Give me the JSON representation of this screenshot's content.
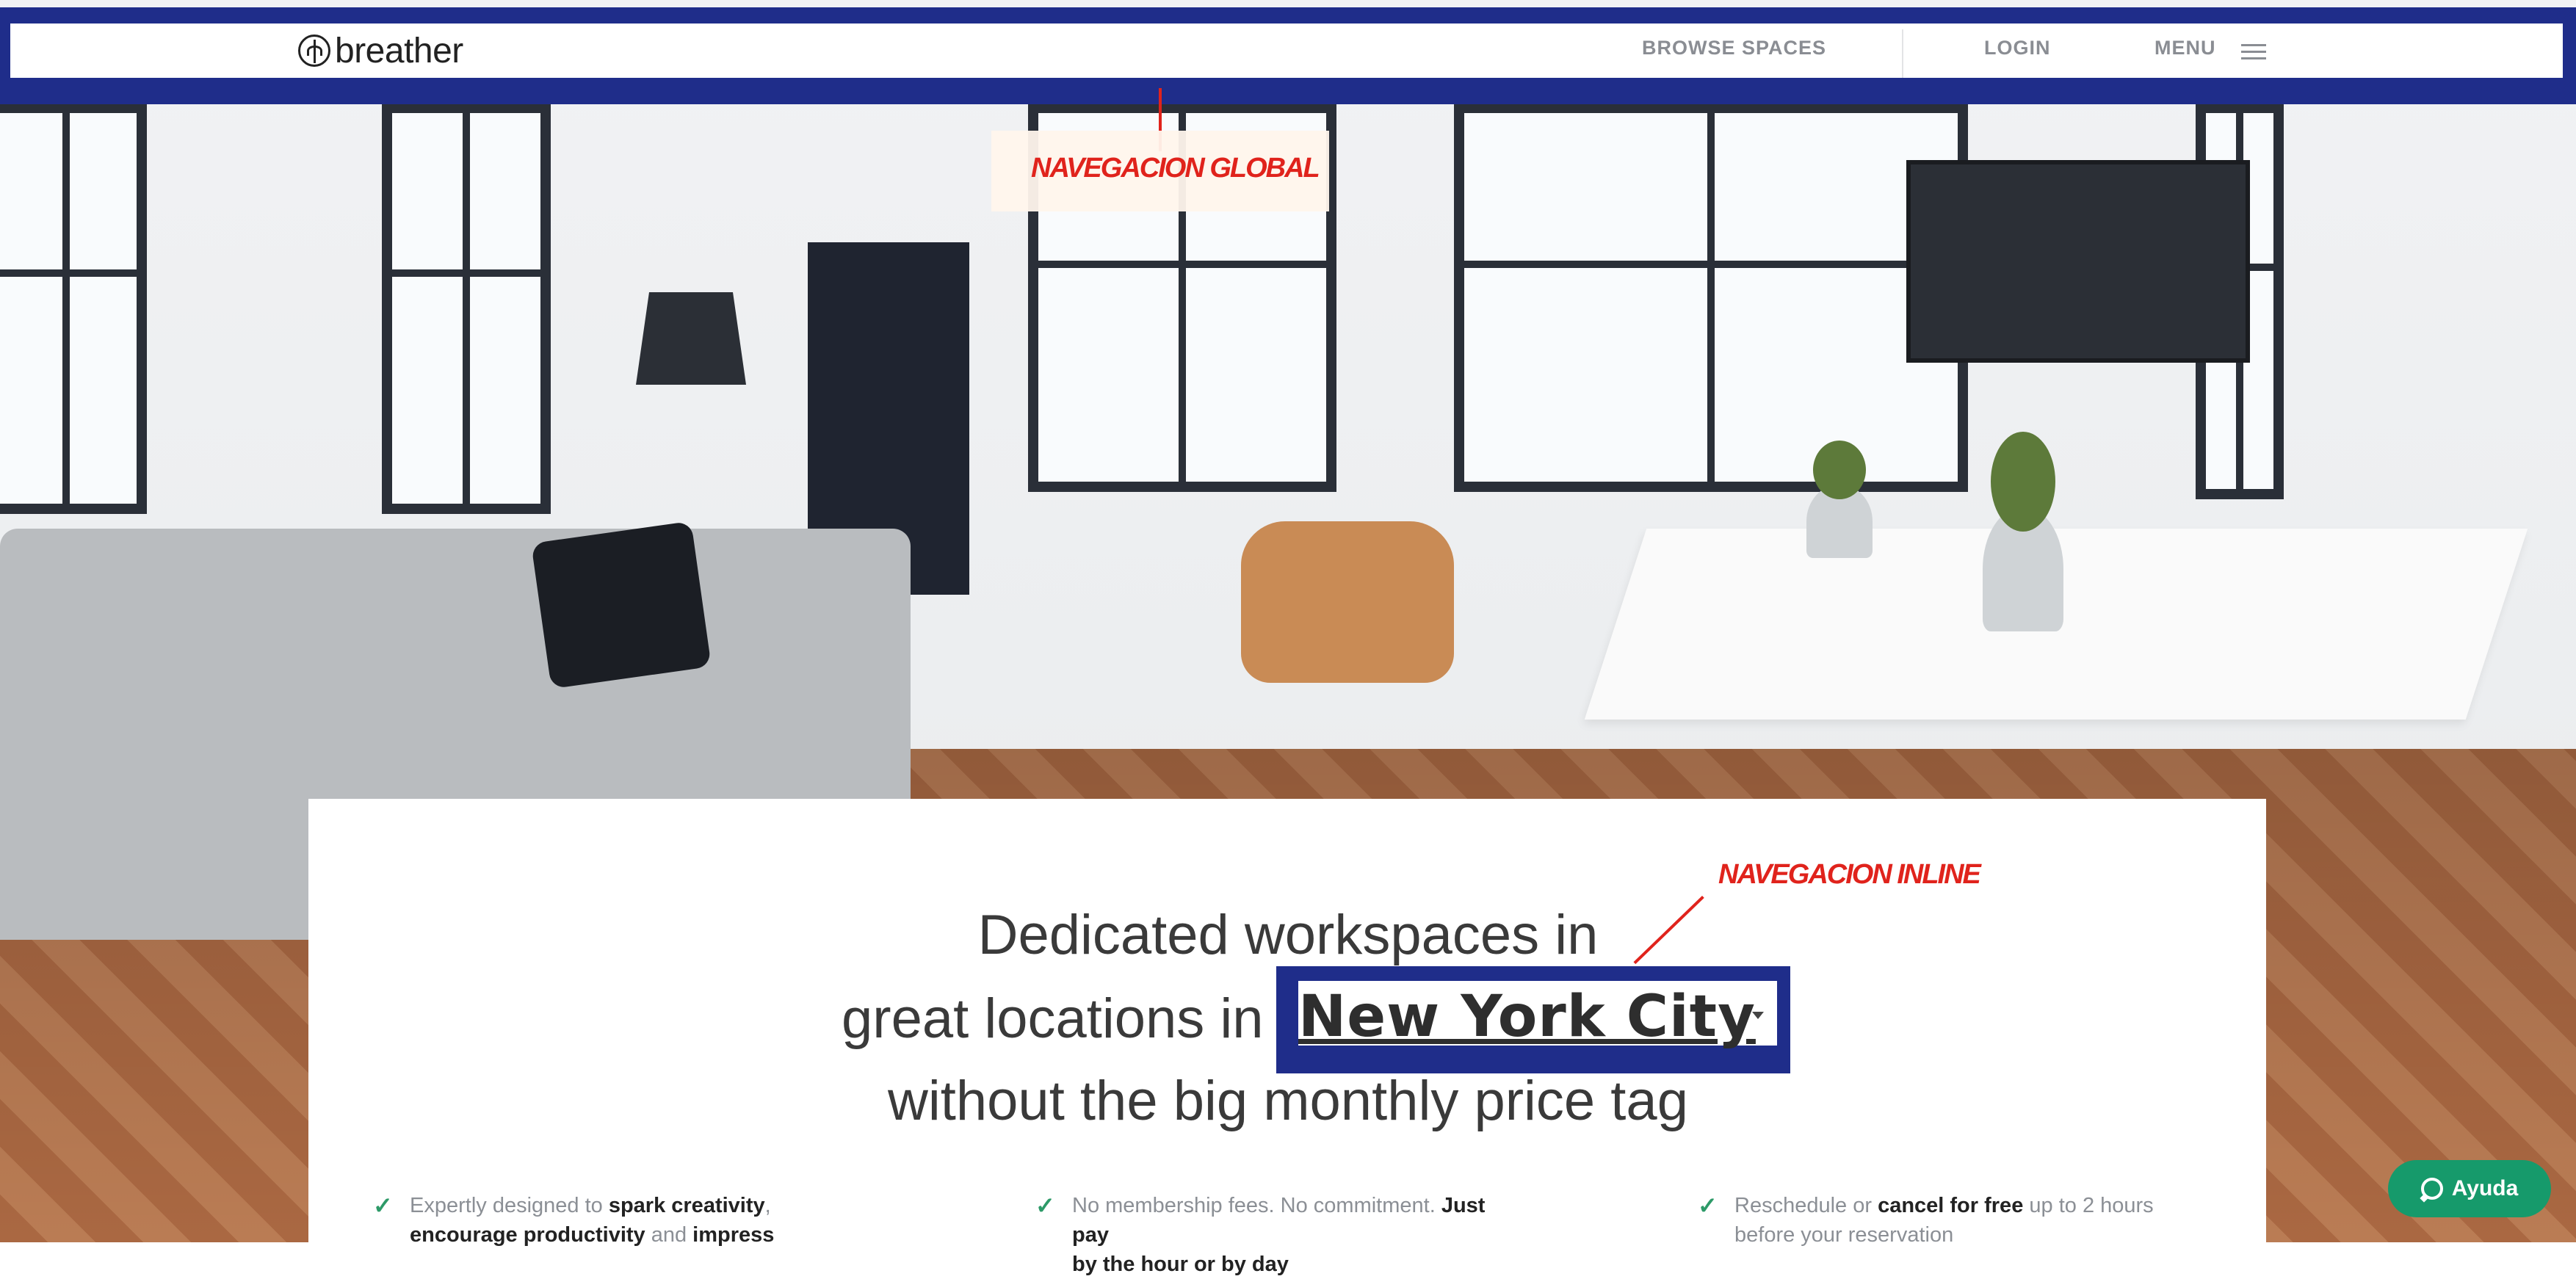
{
  "brand": {
    "logo_text": "breather",
    "logo_icon": "breather-leaf-icon"
  },
  "nav": {
    "browse_spaces": "BROWSE SPACES",
    "login": "LOGIN",
    "menu": "MENU",
    "menu_icon": "hamburger-icon"
  },
  "annotations": {
    "global_nav": "NAVEGACION GLOBAL",
    "inline_nav": "NAVEGACION INLINE"
  },
  "hero": {
    "line1": "Dedicated workspaces in",
    "line2_prefix": "great locations in",
    "city": "New York City",
    "line3": "without the big monthly price tag"
  },
  "features": [
    {
      "pre": "Expertly designed to ",
      "b1": "spark creativity",
      "mid": ",",
      "line2_b": "encourage productivity",
      "line2_mid": " and ",
      "line2_b2": "impress"
    },
    {
      "pre": "No membership fees. No commitment. ",
      "b1": "Just pay",
      "line2_b": "by the hour or by day"
    },
    {
      "pre": "Reschedule or ",
      "b1": "cancel for free",
      "mid": " up to 2 hours",
      "line2": "before your reservation"
    }
  ],
  "help": {
    "label": "Ayuda",
    "icon": "chat-bubble-icon"
  },
  "colors": {
    "annotation_frame": "#1f2d8a",
    "annotation_text": "#e0231c",
    "check": "#2d9a68",
    "help_button": "#169a6b"
  }
}
